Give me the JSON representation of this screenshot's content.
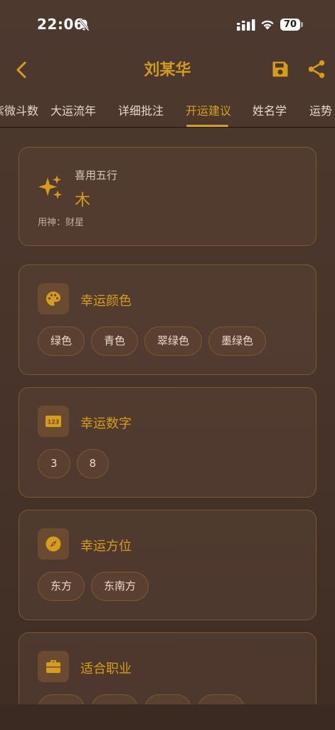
{
  "status_bar": {
    "time": "22:06",
    "battery": "70"
  },
  "app_bar": {
    "title": "刘某华"
  },
  "tabs": [
    {
      "label": "紫微斗数"
    },
    {
      "label": "大运流年"
    },
    {
      "label": "详细批注"
    },
    {
      "label": "开运建议",
      "active": true
    },
    {
      "label": "姓名学"
    },
    {
      "label": "运势"
    }
  ],
  "xiyong": {
    "label": "喜用五行",
    "value": "木",
    "yongshen": "用神：财星"
  },
  "lucky_color": {
    "title": "幸运颜色",
    "chips": [
      "绿色",
      "青色",
      "翠绿色",
      "墨绿色"
    ]
  },
  "lucky_number": {
    "title": "幸运数字",
    "chips": [
      "3",
      "8"
    ]
  },
  "lucky_direction": {
    "title": "幸运方位",
    "chips": [
      "东方",
      "东南方"
    ]
  },
  "career": {
    "title": "适合职业"
  },
  "colors": {
    "accent": "#d4a020",
    "background": "#4a362c",
    "card_border": "#7a5a2c"
  }
}
